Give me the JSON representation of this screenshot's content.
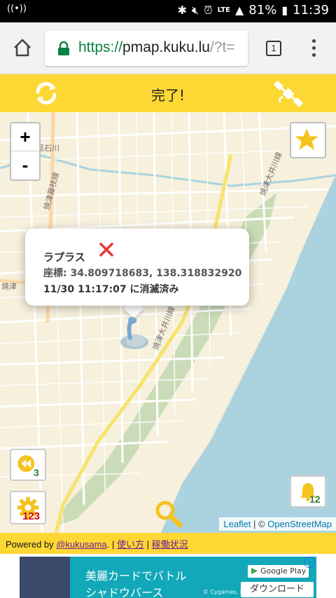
{
  "status_bar": {
    "battery": "81%",
    "time": "11:39",
    "network": "LTE"
  },
  "browser": {
    "url_scheme": "https://",
    "url_host": "pmap.kuku.lu",
    "url_rest": "/?t=",
    "tab_count": "1"
  },
  "app_header": {
    "title": "完了!"
  },
  "map": {
    "zoom_in": "+",
    "zoom_out": "-",
    "popup": {
      "name": "ラプラス",
      "coords": "座標: 34.809718683, 138.318832920",
      "vanished": "11/30 11:17:07 に消滅済み"
    },
    "rewind_count": "3",
    "settings_count": "123",
    "notify_count": "12",
    "attribution": {
      "leaflet": "Leaflet",
      "sep": " | © ",
      "osm": "OpenStreetMap"
    }
  },
  "footer": {
    "powered_by": "Powered by ",
    "author": "@kukusama",
    "sep1": ". | ",
    "howto": "使い方",
    "sep2": " | ",
    "status": "稼働状況"
  },
  "ad": {
    "title1": "美麗カードでバトル",
    "title2": "シャドウバース",
    "store": "Google Play",
    "copyright": "© Cygames, Inc.",
    "cta": "ダウンロード",
    "info": "i"
  },
  "colors": {
    "header": "#fdd835",
    "sea": "#aad3df",
    "land": "#f6f0dc",
    "park": "#c5d9b2"
  }
}
